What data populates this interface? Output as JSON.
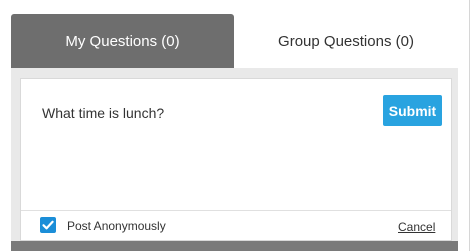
{
  "tabs": {
    "my_questions": "My Questions (0)",
    "group_questions": "Group Questions (0)"
  },
  "composer": {
    "question_text": "What time is lunch?",
    "submit_label": "Submit",
    "post_anonymously_label": "Post Anonymously",
    "post_anonymously_checked": true,
    "cancel_label": "Cancel"
  },
  "colors": {
    "active_tab": "#6e6e6e",
    "submit_button": "#29a3e0",
    "checkbox": "#1b8ed8"
  }
}
